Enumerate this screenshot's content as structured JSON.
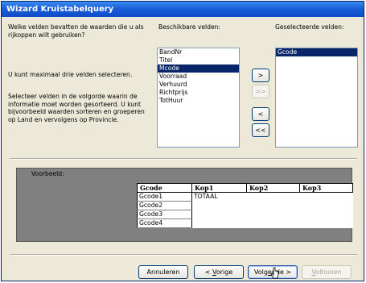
{
  "window": {
    "title": "Wizard Kruistabelquery"
  },
  "left_panel": {
    "question": "Welke velden bevatten de waarden die u als rijkoppen wilt gebruiken?",
    "max_note": "U kunt maximaal drie velden selecteren.",
    "order_note": "Selecteer velden in de volgorde waarin de informatie moet worden gesorteerd. U kunt bijvoorbeeld waarden sorteren en groeperen op Land en vervolgens op Provincie."
  },
  "available": {
    "label": "Beschikbare velden:",
    "items": [
      "BandNr",
      "Titel",
      "Mcode",
      "Voorraad",
      "Verhuurd",
      "Richtprijs",
      "TotHuur"
    ],
    "selected": "Mcode"
  },
  "selected_fields": {
    "label": "Geselecteerde velden:",
    "items": [
      "Gcode"
    ],
    "selected": "Gcode"
  },
  "move_buttons": {
    "add": ">",
    "add_all": ">>",
    "remove": "<",
    "remove_all": "<<"
  },
  "preview": {
    "label": "Voorbeeld:",
    "headers": [
      "Gcode",
      "Kop1",
      "Kop2",
      "Kop3"
    ],
    "rows": [
      "Gcode1",
      "Gcode2",
      "Gcode3",
      "Gcode4"
    ],
    "first_value": "TOTAAL"
  },
  "footer": {
    "cancel": "Annuleren",
    "back_prefix": "< ",
    "back_key": "V",
    "back_rest": "orige",
    "next_prefix": "Volg",
    "next_key": "e",
    "next_rest": "nde >",
    "finish_key": "V",
    "finish_rest": "oltooien"
  }
}
